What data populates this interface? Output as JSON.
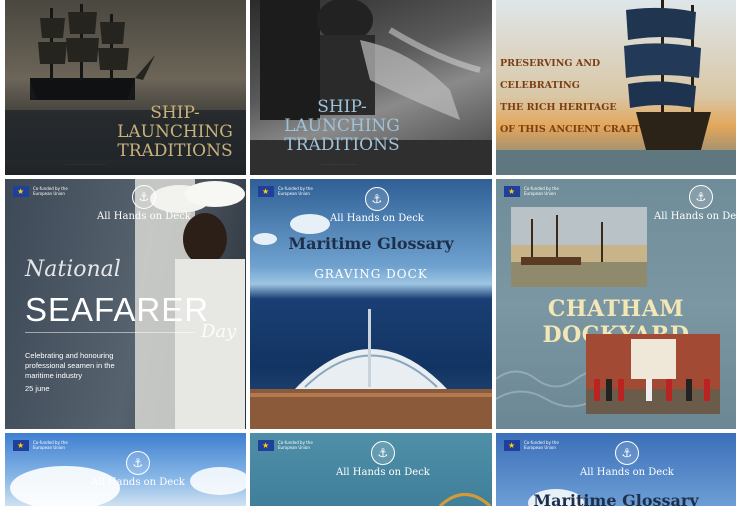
{
  "posts": [
    {
      "title_line1": "SHIP-LAUNCHING",
      "title_line2": "TRADITIONS"
    },
    {
      "title_line1": "SHIP-LAUNCHING",
      "title_line2": "TRADITIONS"
    },
    {
      "lines": [
        "PRESERVING AND",
        "CELEBRATING",
        "THE RICH HERITAGE",
        "OF THIS ANCIENT CRAFT"
      ]
    },
    {
      "eu_text": "Co-funded by the European Union",
      "brand": "All Hands on Deck",
      "script_word": "National",
      "big_word": "SEAFARER",
      "script_word2": "Day",
      "body": "Celebrating and honouring professional seamen in the maritime industry",
      "date": "25 june"
    },
    {
      "eu_text": "Co-funded by the European Union",
      "brand": "All Hands on Deck",
      "title": "Maritime Glossary",
      "subtitle": "GRAVING DOCK"
    },
    {
      "eu_text": "Co-funded by the European Union",
      "brand": "All Hands on Deck",
      "title": "CHATHAM DOCKYARD"
    },
    {
      "eu_text": "Co-funded by the European Union",
      "brand": "All Hands on Deck"
    },
    {
      "eu_text": "Co-funded by the European Union",
      "brand": "All Hands on Deck"
    },
    {
      "eu_text": "Co-funded by the European Union",
      "brand": "All Hands on Deck",
      "title": "Maritime Glossary"
    }
  ]
}
